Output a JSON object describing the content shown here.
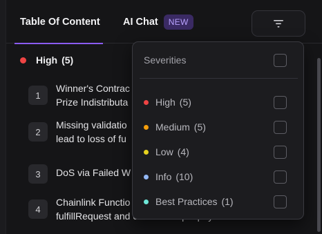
{
  "tabs": {
    "toc_label": "Table Of Content",
    "chat_label": "AI Chat",
    "chat_badge": "NEW"
  },
  "section": {
    "label": "High",
    "count": "(5)",
    "color": "#ef4444"
  },
  "items": [
    {
      "num": "1",
      "text": "Winner's Contrac\nPrize Indistributa"
    },
    {
      "num": "2",
      "text": "Missing validatio\nlead to loss of fu"
    },
    {
      "num": "3",
      "text": "DoS via Failed W"
    },
    {
      "num": "4",
      "text": "Chainlink Functio\nfulfillRequest and cause multiple payouts"
    }
  ],
  "filter": {
    "header": "Severities",
    "options": [
      {
        "label": "High",
        "count": "(5)",
        "color": "#ef4444"
      },
      {
        "label": "Medium",
        "count": "(5)",
        "color": "#f59e0b"
      },
      {
        "label": "Low",
        "count": "(4)",
        "color": "#e6d21f"
      },
      {
        "label": "Info",
        "count": "(10)",
        "color": "#93b8f5"
      },
      {
        "label": "Best Practices",
        "count": "(1)",
        "color": "#6ee7d8"
      }
    ]
  }
}
